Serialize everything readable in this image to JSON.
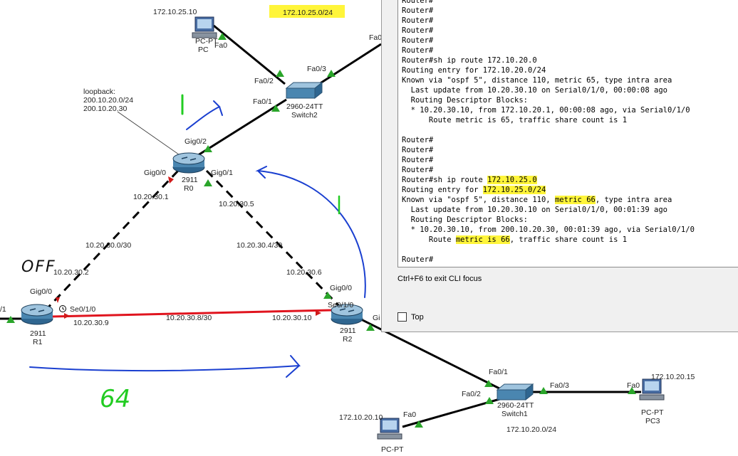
{
  "subnets": {
    "top_lan": "172.10.25.0/24",
    "r0_r1": "10.20.30.0/30",
    "r0_r2": "10.20.30.4/30",
    "r1_r2": "10.20.30.8/30",
    "bottom_lan": "172.10.20.0/24"
  },
  "colors": {
    "highlight": "#fff53a",
    "serial_link": "#e0141e",
    "annotation_blue": "#1a3fd0",
    "annotation_green": "#22cc22",
    "port_up": "#2aa52a"
  },
  "devices": {
    "pc_top": {
      "ip": "172.10.25.10",
      "model": "PC-PT",
      "name": "PC",
      "iface": "Fa0"
    },
    "switch2": {
      "model": "2960-24TT",
      "name": "Switch2",
      "ports": {
        "fa02": "Fa0/2",
        "fa03": "Fa0/3",
        "fa01": "Fa0/1"
      },
      "partial": "Fa0"
    },
    "r0": {
      "model": "2911",
      "name": "R0",
      "gig02": "Gig0/2",
      "gig00": "Gig0/0",
      "gig01": "Gig0/1",
      "ip_gig00": "10.20.30.1",
      "ip_gig01": "10.20.30.5"
    },
    "loopback": {
      "title": "loopback:",
      "net": "200.10.20.0/24",
      "ip": "200.10.20.30"
    },
    "r1": {
      "model": "2911",
      "name": "R1",
      "gig00": "Gig0/0",
      "se010": "Se0/1/0",
      "ip_gig00": "10.20.30.2",
      "ip_se": "10.20.30.9",
      "left_port": "/1"
    },
    "r2": {
      "model": "2911",
      "name": "R2",
      "gig00": "Gig0/0",
      "se010": "Se0/1/0",
      "ip_gig00": "10.20.30.6",
      "ip_se": "10.20.30.10",
      "gig_partial": "Gi"
    },
    "switch1": {
      "model": "2960-24TT",
      "name": "Switch1",
      "fa01": "Fa0/1",
      "fa02": "Fa0/2",
      "fa03": "Fa0/3"
    },
    "pc_bottom": {
      "ip": "172.10.20.10",
      "model": "PC-PT",
      "iface": "Fa0"
    },
    "pc3": {
      "ip": "172.10.20.15",
      "model": "PC-PT",
      "name": "PC3",
      "iface": "Fa0"
    }
  },
  "annotations": {
    "off": "OFF",
    "one_a": "1",
    "one_b": "1",
    "cost": "64"
  },
  "cli": {
    "lines": [
      [
        "Router#"
      ],
      [
        "Router#"
      ],
      [
        "Router#"
      ],
      [
        "Router#"
      ],
      [
        "Router#"
      ],
      [
        "Router#"
      ],
      [
        "Router#sh ip route 172.10.20.0"
      ],
      [
        "Routing entry for 172.10.20.0/24"
      ],
      [
        "Known via \"ospf 5\", distance 110, metric 65, type intra area"
      ],
      [
        "  Last update from 10.20.30.10 on Serial0/1/0, 00:00:08 ago"
      ],
      [
        "  Routing Descriptor Blocks:"
      ],
      [
        "  * 10.20.30.10, from 172.10.20.1, 00:00:08 ago, via Serial0/1/0"
      ],
      [
        "      Route metric is 65, traffic share count is 1"
      ],
      [
        ""
      ],
      [
        "Router#"
      ],
      [
        "Router#"
      ],
      [
        "Router#"
      ],
      [
        "Router#"
      ],
      [
        "Router#sh ip route ",
        "172.10.25.0"
      ],
      [
        "Routing entry for ",
        "172.10.25.0/24"
      ],
      [
        "Known via \"ospf 5\", distance 110, ",
        "metric 66",
        ", type intra area"
      ],
      [
        "  Last update from 10.20.30.10 on Serial0/1/0, 00:01:39 ago"
      ],
      [
        "  Routing Descriptor Blocks:"
      ],
      [
        "  * 10.20.30.10, from 200.10.20.30, 00:01:39 ago, via Serial0/1/0"
      ],
      [
        "      Route ",
        "metric is 66",
        ", traffic share count is 1"
      ],
      [
        ""
      ],
      [
        "Router#"
      ]
    ],
    "hint": "Ctrl+F6 to exit CLI focus",
    "top_label": "Top"
  }
}
